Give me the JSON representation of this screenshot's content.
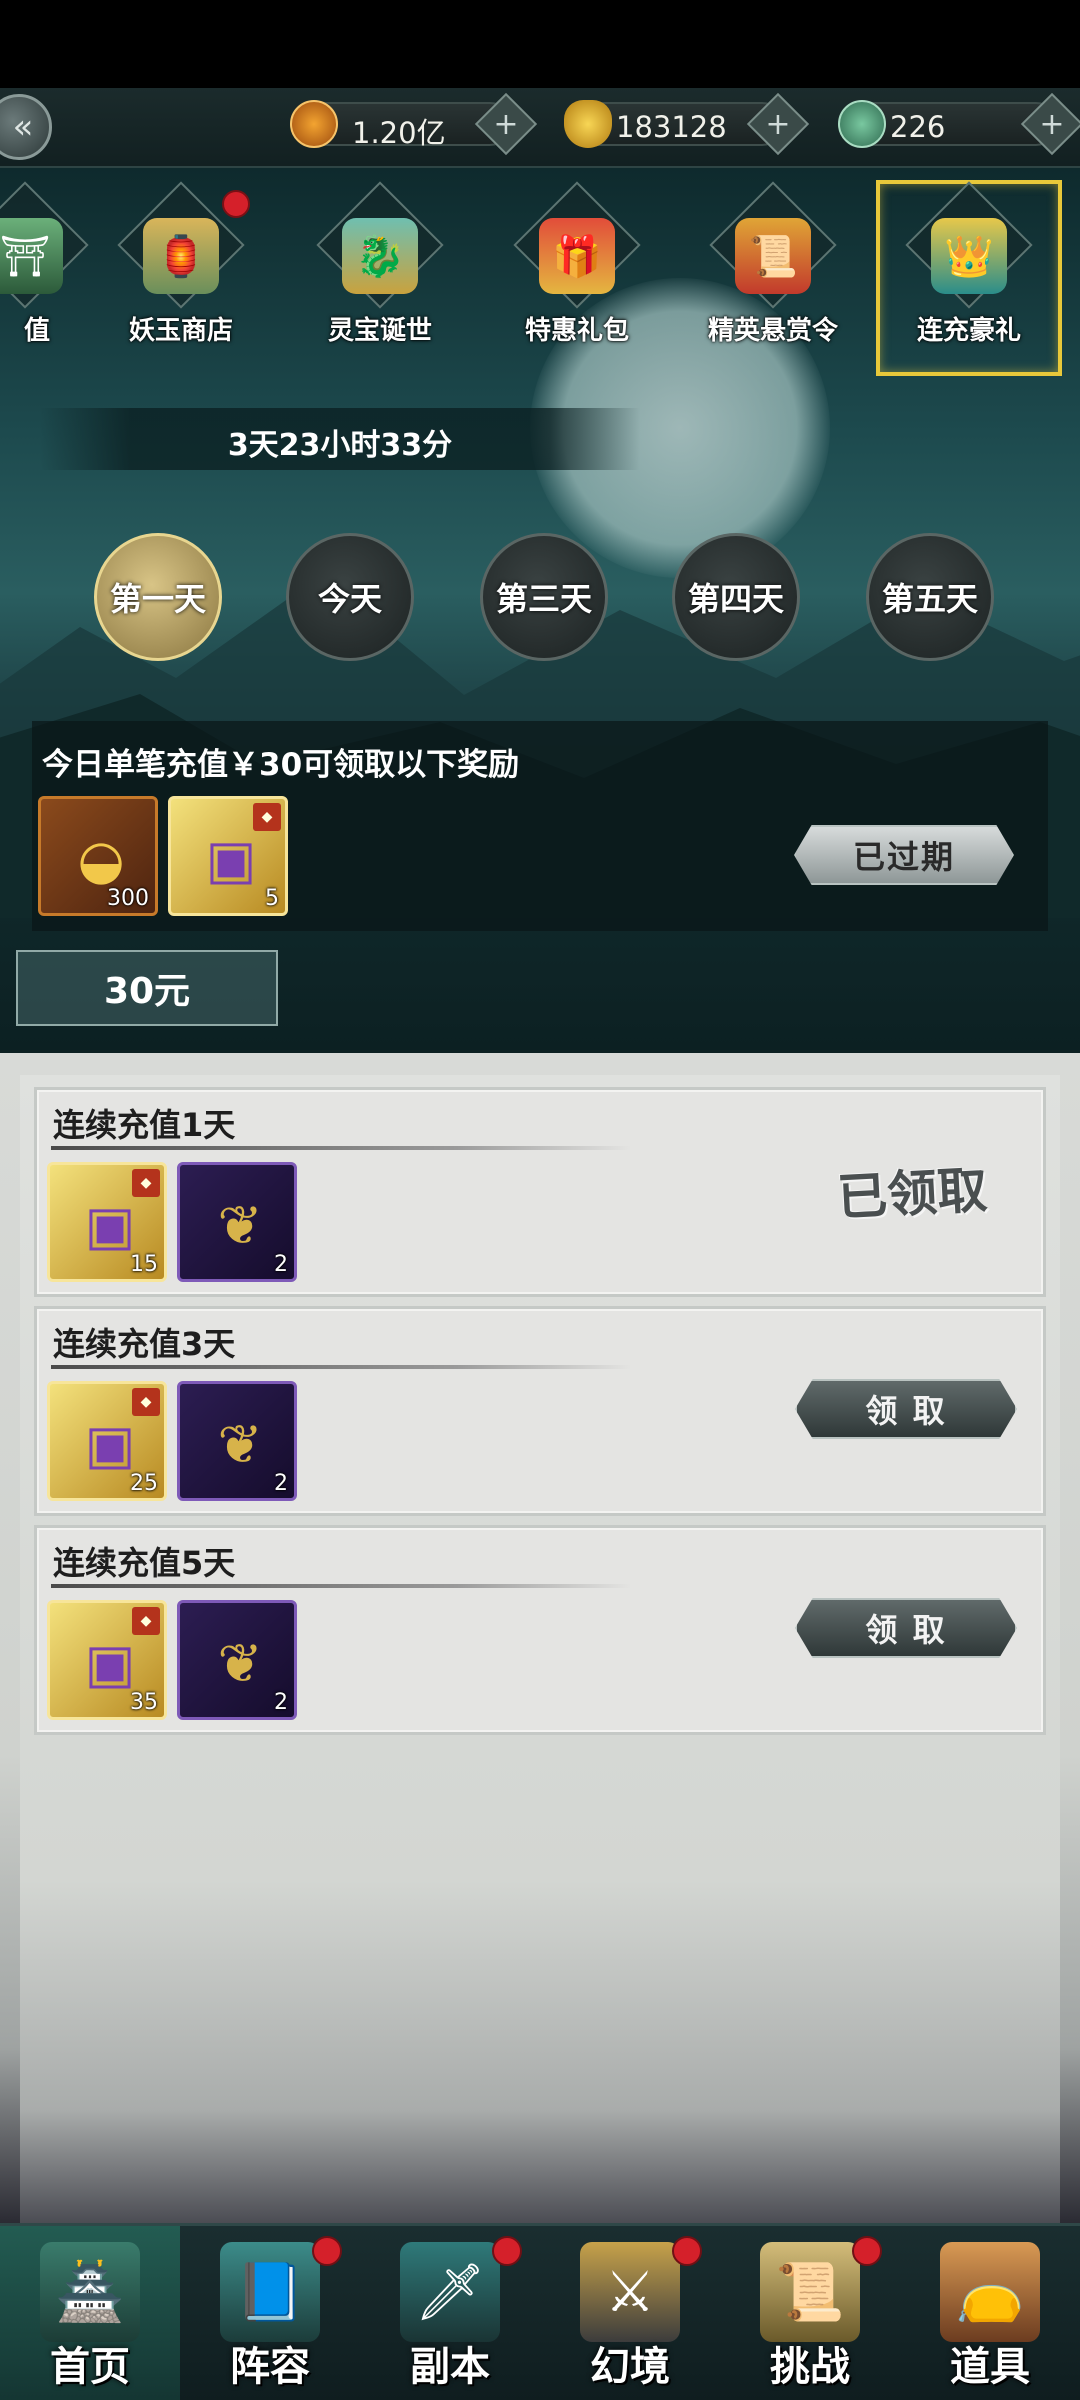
{
  "currency": [
    {
      "icon": "coin-icon",
      "value": "1.20亿"
    },
    {
      "icon": "gold-ingot-icon",
      "value": "183128"
    },
    {
      "icon": "jade-dragon-icon",
      "value": "226"
    }
  ],
  "tabs": [
    {
      "label": "值",
      "icon": "shop-icon"
    },
    {
      "label": "妖玉商店",
      "icon": "shop-icon"
    },
    {
      "label": "灵宝诞世",
      "icon": "treasure-icon"
    },
    {
      "label": "特惠礼包",
      "icon": "gift-icon"
    },
    {
      "label": "精英悬赏令",
      "icon": "bounty-icon"
    },
    {
      "label": "连充豪礼",
      "icon": "crown-icon"
    }
  ],
  "timer": "3天23小时33分",
  "days": [
    "第一天",
    "今天",
    "第三天",
    "第四天",
    "第五天"
  ],
  "daily_reward": {
    "title": "今日单笔充值￥30可领取以下奖励",
    "items": [
      {
        "icon": "gold-ingot-icon",
        "qty": "300"
      },
      {
        "icon": "treasure-chest-icon",
        "qty": "5"
      }
    ],
    "button": "已过期"
  },
  "price": "30元",
  "tiers": [
    {
      "title": "连续充值1天",
      "items": [
        {
          "icon": "treasure-chest-icon",
          "qty": "15"
        },
        {
          "icon": "seahorse-icon",
          "qty": "2"
        }
      ],
      "status": "已领取"
    },
    {
      "title": "连续充值3天",
      "items": [
        {
          "icon": "treasure-chest-icon",
          "qty": "25"
        },
        {
          "icon": "seahorse-icon",
          "qty": "2"
        }
      ],
      "button": "领 取"
    },
    {
      "title": "连续充值5天",
      "items": [
        {
          "icon": "treasure-chest-icon",
          "qty": "35"
        },
        {
          "icon": "seahorse-icon",
          "qty": "2"
        }
      ],
      "button": "领 取"
    }
  ],
  "nav": [
    "首页",
    "阵容",
    "副本",
    "幻境",
    "挑战",
    "道具"
  ]
}
